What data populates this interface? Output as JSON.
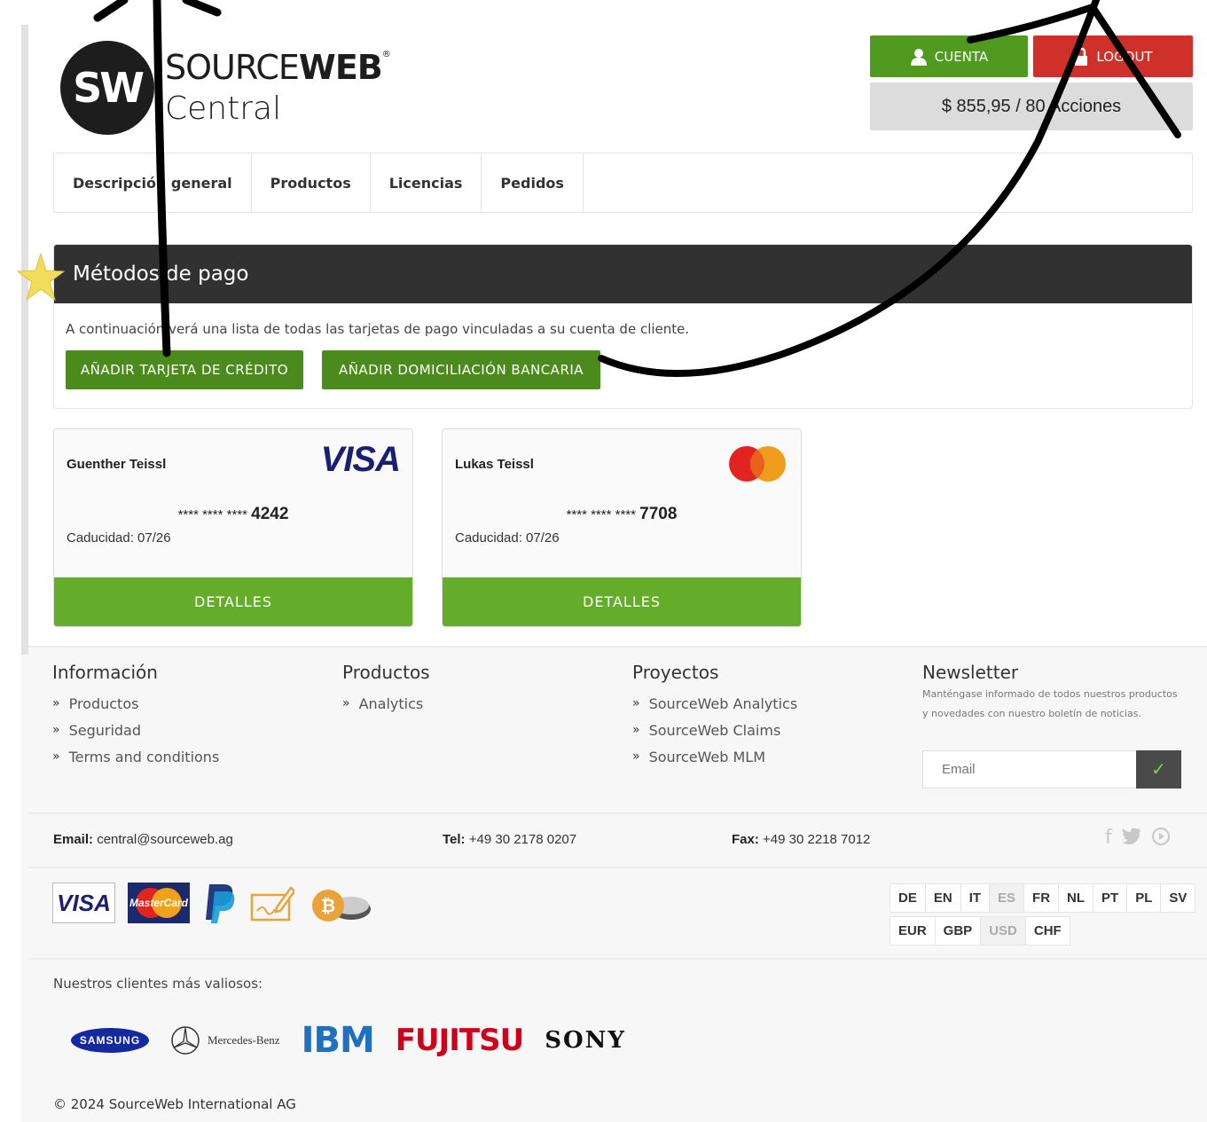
{
  "logo": {
    "circle_text": "SW",
    "brand_light": "SOURCE",
    "brand_bold": "WEB",
    "registered": "®",
    "sub": "Central"
  },
  "header": {
    "cuenta_label": "CUENTA",
    "logout_label": "LOGOUT",
    "balance": "$ 855,95 / 80 Acciones"
  },
  "nav": {
    "items": [
      {
        "label": "Descripción general"
      },
      {
        "label": "Productos"
      },
      {
        "label": "Licencias"
      },
      {
        "label": "Pedidos"
      }
    ]
  },
  "payment_panel": {
    "title": "Métodos de pago",
    "description": "A continuación verá una lista de todas las tarjetas de pago vinculadas a su cuenta de cliente.",
    "add_card_label": "AÑADIR TARJETA DE CRÉDITO",
    "add_debit_label": "AÑADIR DOMICILIACIÓN BANCARIA"
  },
  "cards": [
    {
      "name": "Guenther Teissl",
      "brand": "VISA",
      "mask": "**** **** ****",
      "last4": "4242",
      "expiry": "Caducidad: 07/26",
      "button": "DETALLES"
    },
    {
      "name": "Lukas Teissl",
      "brand": "mastercard",
      "mask": "**** **** ****",
      "last4": "7708",
      "expiry": "Caducidad: 07/26",
      "button": "DETALLES"
    }
  ],
  "footer": {
    "col1": {
      "title": "Información",
      "links": [
        "Productos",
        "Seguridad",
        "Terms and conditions"
      ]
    },
    "col2": {
      "title": "Productos",
      "links": [
        "Analytics"
      ]
    },
    "col3": {
      "title": "Proyectos",
      "links": [
        "SourceWeb Analytics",
        "SourceWeb Claims",
        "SourceWeb MLM"
      ]
    },
    "newsletter": {
      "title": "Newsletter",
      "text": "Manténgase informado de todos nuestros productos y novedades con nuestro boletín de noticias.",
      "placeholder": "Email"
    },
    "contact": {
      "email_label": "Email:",
      "email": "central@sourceweb.ag",
      "tel_label": "Tel:",
      "tel": "+49 30 2178 0207",
      "fax_label": "Fax:",
      "fax": "+49 30 2218 7012"
    },
    "payment_logos": {
      "visa": "VISA",
      "mastercard": "MasterCard"
    },
    "languages": [
      "DE",
      "EN",
      "IT",
      "ES",
      "FR",
      "NL",
      "PT",
      "PL",
      "SV"
    ],
    "active_language": "ES",
    "currencies": [
      "EUR",
      "GBP",
      "USD",
      "CHF"
    ],
    "active_currency": "USD",
    "clients_label": "Nuestros clientes más valiosos:",
    "clients": {
      "samsung": "SAMSUNG",
      "mercedes": "Mercedes-Benz",
      "ibm": "IBM",
      "fujitsu": "FUJITSU",
      "sony": "SONY"
    },
    "copyright": "© 2024 SourceWeb International AG"
  },
  "colors": {
    "green": "#4f9a1f",
    "red": "#d0302a",
    "card_green": "#64ad2a",
    "dark_header": "#313131"
  }
}
